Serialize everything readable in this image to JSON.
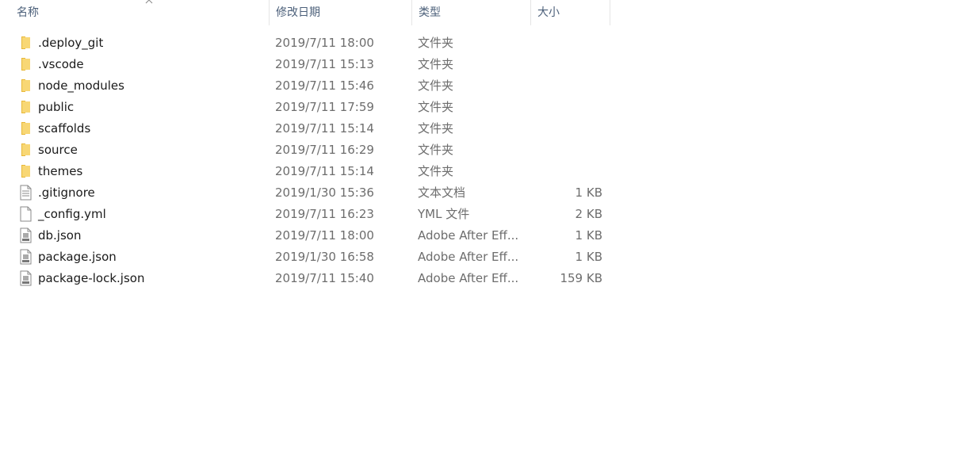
{
  "columns": {
    "name": "名称",
    "date": "修改日期",
    "type": "类型",
    "size": "大小"
  },
  "sort_icon": "chevron-up-icon",
  "files": [
    {
      "name": ".deploy_git",
      "date": "2019/7/11 18:00",
      "type": "文件夹",
      "size": "",
      "icon": "folder-icon"
    },
    {
      "name": ".vscode",
      "date": "2019/7/11 15:13",
      "type": "文件夹",
      "size": "",
      "icon": "folder-icon"
    },
    {
      "name": "node_modules",
      "date": "2019/7/11 15:46",
      "type": "文件夹",
      "size": "",
      "icon": "folder-icon"
    },
    {
      "name": "public",
      "date": "2019/7/11 17:59",
      "type": "文件夹",
      "size": "",
      "icon": "folder-icon"
    },
    {
      "name": "scaffolds",
      "date": "2019/7/11 15:14",
      "type": "文件夹",
      "size": "",
      "icon": "folder-icon"
    },
    {
      "name": "source",
      "date": "2019/7/11 16:29",
      "type": "文件夹",
      "size": "",
      "icon": "folder-icon"
    },
    {
      "name": "themes",
      "date": "2019/7/11 15:14",
      "type": "文件夹",
      "size": "",
      "icon": "folder-icon"
    },
    {
      "name": ".gitignore",
      "date": "2019/1/30 15:36",
      "type": "文本文档",
      "size": "1 KB",
      "icon": "text-file-icon"
    },
    {
      "name": "_config.yml",
      "date": "2019/7/11 16:23",
      "type": "YML 文件",
      "size": "2 KB",
      "icon": "blank-file-icon"
    },
    {
      "name": "db.json",
      "date": "2019/7/11 18:00",
      "type": "Adobe After Eff...",
      "size": "1 KB",
      "icon": "json-file-icon"
    },
    {
      "name": "package.json",
      "date": "2019/1/30 16:58",
      "type": "Adobe After Eff...",
      "size": "1 KB",
      "icon": "json-file-icon"
    },
    {
      "name": "package-lock.json",
      "date": "2019/7/11 15:40",
      "type": "Adobe After Eff...",
      "size": "159 KB",
      "icon": "json-file-icon"
    }
  ],
  "colors": {
    "folder": "#f8d775",
    "folder_dark": "#e8b83a",
    "header_text": "#4c607a",
    "meta_text": "#6d6d6d"
  }
}
